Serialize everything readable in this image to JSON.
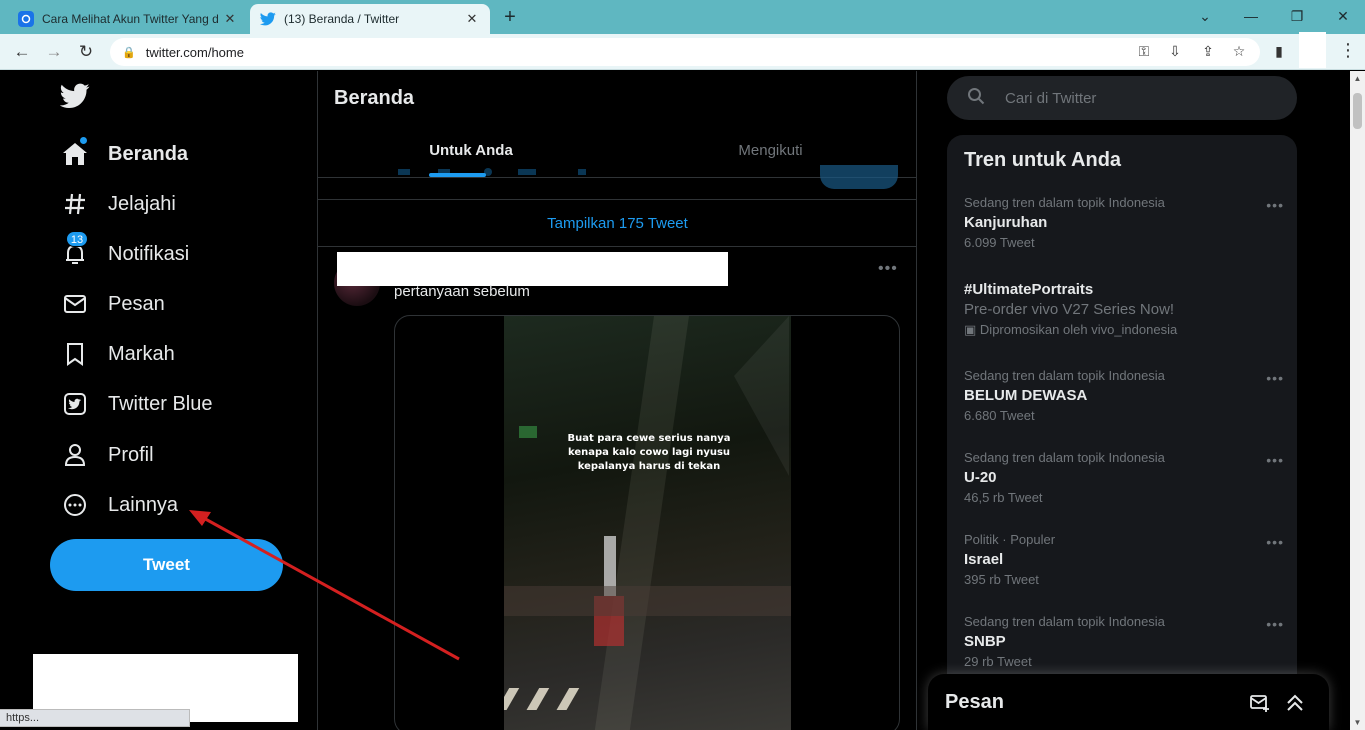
{
  "browser": {
    "tabs": [
      {
        "title": "Cara Melihat Akun Twitter Yang d",
        "active": false
      },
      {
        "title": "(13) Beranda / Twitter",
        "active": true
      }
    ],
    "url": "twitter.com/home",
    "status_url": "https..."
  },
  "nav": {
    "items": [
      {
        "label": "Beranda",
        "icon": "home-icon"
      },
      {
        "label": "Jelajahi",
        "icon": "hashtag-icon"
      },
      {
        "label": "Notifikasi",
        "icon": "bell-icon",
        "badge": "13"
      },
      {
        "label": "Pesan",
        "icon": "mail-icon"
      },
      {
        "label": "Markah",
        "icon": "bookmark-icon"
      },
      {
        "label": "Twitter Blue",
        "icon": "twitter-blue-icon"
      },
      {
        "label": "Profil",
        "icon": "person-icon"
      },
      {
        "label": "Lainnya",
        "icon": "more-circle-icon"
      }
    ],
    "tweet_button": "Tweet"
  },
  "main": {
    "title": "Beranda",
    "tabs": [
      "Untuk Anda",
      "Mengikuti"
    ],
    "show_tweets": "Tampilkan 175 Tweet",
    "tweet": {
      "text": "pertanyaan sebelum",
      "video_caption": "Buat para cewe serius nanya kenapa kalo cowo lagi nyusu kepalanya harus di tekan"
    }
  },
  "right": {
    "search_placeholder": "Cari di Twitter",
    "trends_title": "Tren untuk Anda",
    "trends": [
      {
        "context": "Sedang tren dalam topik Indonesia",
        "topic": "Kanjuruhan",
        "count": "6.099 Tweet"
      },
      {
        "context": "",
        "topic": "#UltimatePortraits",
        "subtitle": "Pre-order vivo V27 Series Now!",
        "promoted": "Dipromosikan oleh vivo_indonesia"
      },
      {
        "context": "Sedang tren dalam topik Indonesia",
        "topic": "BELUM DEWASA",
        "count": "6.680 Tweet"
      },
      {
        "context": "Sedang tren dalam topik Indonesia",
        "topic": "U-20",
        "count": "46,5 rb Tweet"
      },
      {
        "context": "Politik · Populer",
        "topic": "Israel",
        "count": "395 rb Tweet"
      },
      {
        "context": "Sedang tren dalam topik Indonesia",
        "topic": "SNBP",
        "count": "29 rb Tweet"
      }
    ],
    "messages_title": "Pesan"
  },
  "colors": {
    "accent": "#1d9bf0",
    "tab_strip": "#5fb7c1",
    "annotation_arrow": "#d42020"
  }
}
